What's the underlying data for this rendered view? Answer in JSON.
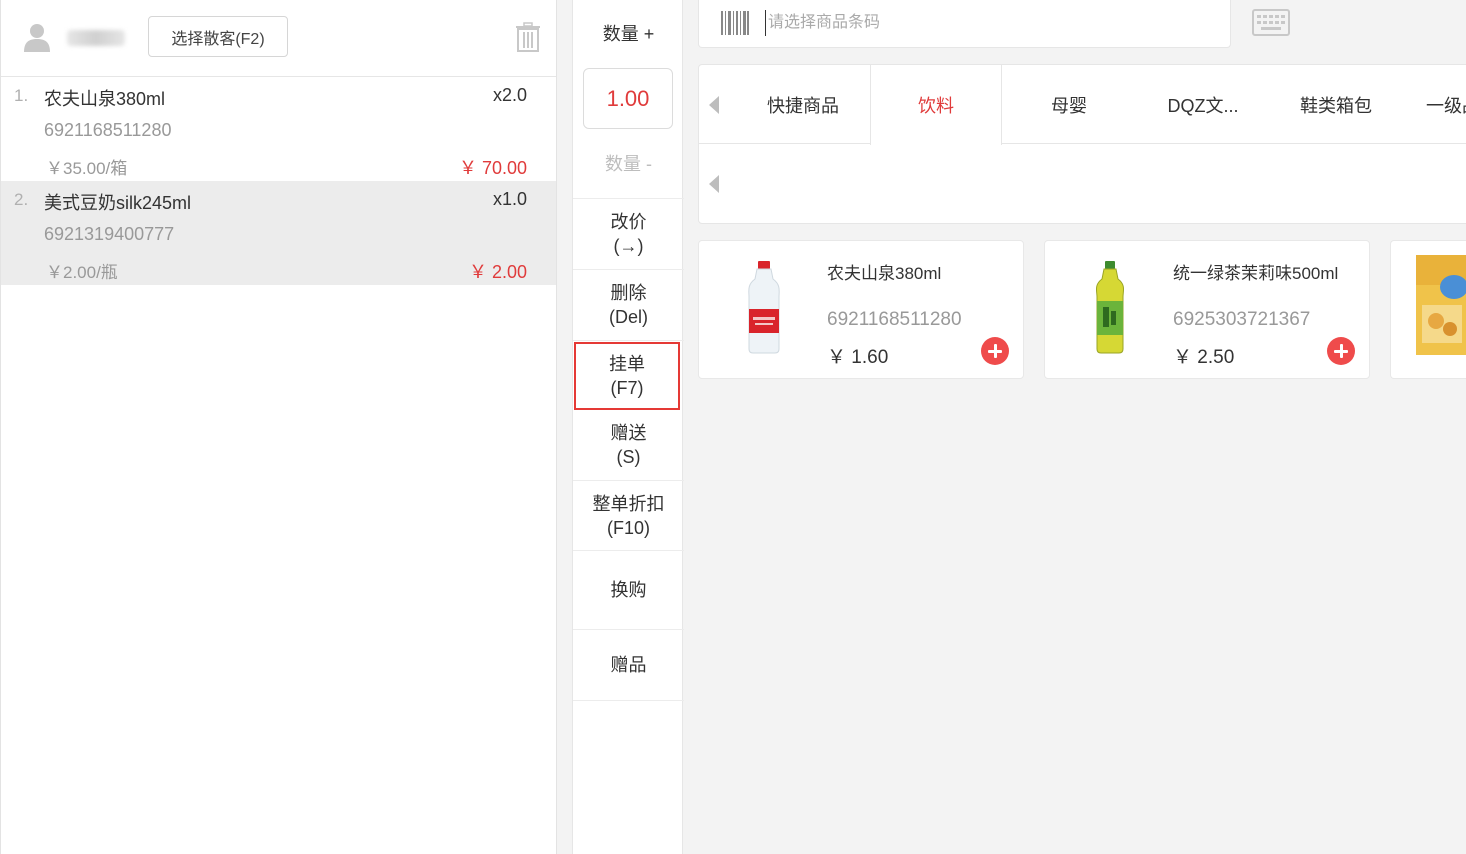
{
  "cart": {
    "customer_button": "选择散客(F2)",
    "items": [
      {
        "index": "1.",
        "name": "农夫山泉380ml",
        "qty": "x2.0",
        "code": "6921168511280",
        "unit_price": "￥35.00/箱",
        "total": "￥ 70.00"
      },
      {
        "index": "2.",
        "name": "美式豆奶silk245ml",
        "qty": "x1.0",
        "code": "6921319400777",
        "unit_price": "￥2.00/瓶",
        "total": "￥ 2.00"
      }
    ]
  },
  "actions": {
    "qty_plus": "数量 +",
    "qty_value": "1.00",
    "qty_minus": "数量 -",
    "change_price": [
      "改价",
      "(→)"
    ],
    "delete": [
      "删除",
      "(Del)"
    ],
    "hold": [
      "挂单",
      "(F7)"
    ],
    "gift_send": [
      "赠送",
      "(S)"
    ],
    "whole_discount": [
      "整单折扣",
      "(F10)"
    ],
    "exchange": "换购",
    "gift_item": "赠品"
  },
  "search": {
    "placeholder": "请选择商品条码"
  },
  "categories": [
    "快捷商品",
    "饮料",
    "母婴",
    "DQZ文...",
    "鞋类箱包",
    "一级品"
  ],
  "active_category": "饮料",
  "products": [
    {
      "name": "农夫山泉380ml",
      "code": "6921168511280",
      "price": "￥ 1.60"
    },
    {
      "name": "统一绿茶茉莉味500ml",
      "code": "6925303721367",
      "price": "￥ 2.50"
    },
    {
      "name": "",
      "code": "",
      "price": ""
    }
  ],
  "colors": {
    "accent": "#e03b3b",
    "highlight_border": "#e53935"
  },
  "icons": [
    "user-icon",
    "trash-icon",
    "barcode-icon",
    "keyboard-icon",
    "arrow-left-icon",
    "add-icon"
  ]
}
